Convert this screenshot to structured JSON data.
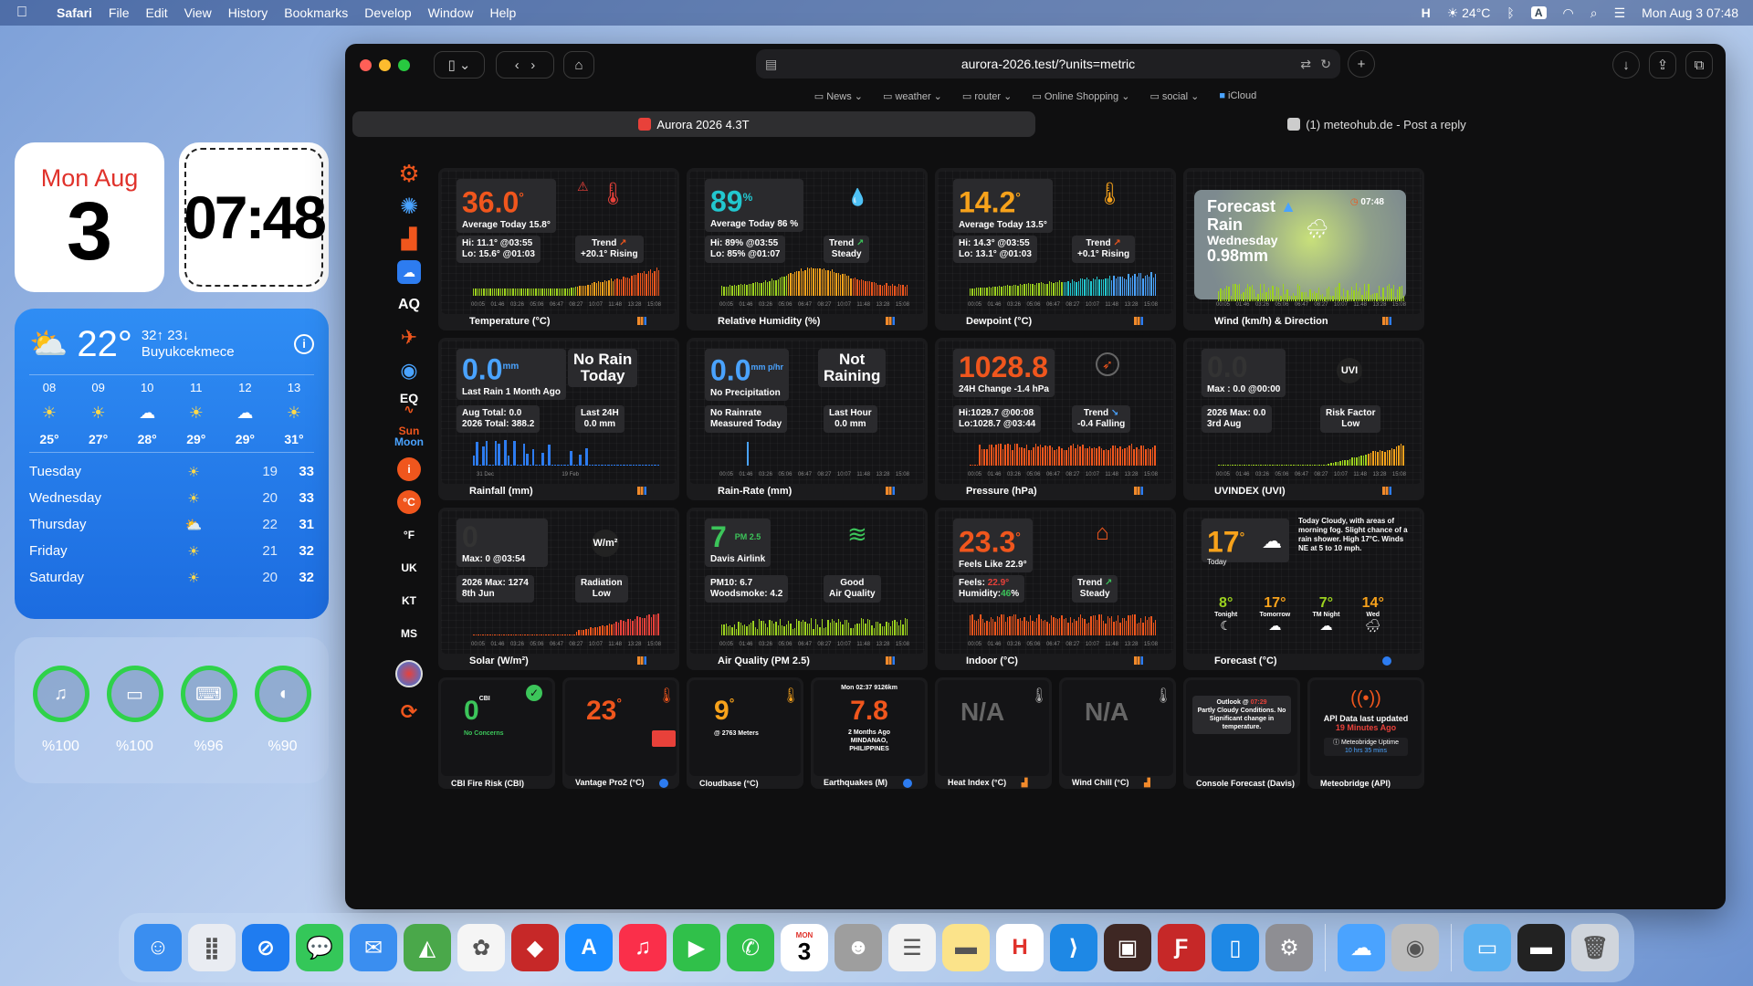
{
  "menubar": {
    "app": "Safari",
    "items": [
      "File",
      "Edit",
      "View",
      "History",
      "Bookmarks",
      "Develop",
      "Window",
      "Help"
    ],
    "weather": "24°C",
    "datetime": "Mon Aug 3  07:48",
    "input_badge": "A"
  },
  "widgets": {
    "date": {
      "day": "Mon Aug",
      "num": "3"
    },
    "clock": {
      "time": "07:48"
    },
    "weather": {
      "temp": "22°",
      "hl": "32↑ 23↓",
      "place": "Buyukcekmece",
      "hours": [
        {
          "h": "08",
          "t": "25°",
          "i": "☀"
        },
        {
          "h": "09",
          "t": "27°",
          "i": "☀"
        },
        {
          "h": "10",
          "t": "28°",
          "i": "☁"
        },
        {
          "h": "11",
          "t": "29°",
          "i": "☀"
        },
        {
          "h": "12",
          "t": "29°",
          "i": "☁"
        },
        {
          "h": "13",
          "t": "31°",
          "i": "☀"
        }
      ],
      "days": [
        {
          "d": "Tuesday",
          "lo": "19",
          "hi": "33",
          "i": "☀"
        },
        {
          "d": "Wednesday",
          "lo": "20",
          "hi": "33",
          "i": "☀"
        },
        {
          "d": "Thursday",
          "lo": "22",
          "hi": "31",
          "i": "⛅"
        },
        {
          "d": "Friday",
          "lo": "21",
          "hi": "32",
          "i": "☀"
        },
        {
          "d": "Saturday",
          "lo": "20",
          "hi": "32",
          "i": "☀"
        }
      ]
    },
    "batteries": [
      {
        "pct": "%100",
        "fill": 1.0
      },
      {
        "pct": "%100",
        "fill": 1.0
      },
      {
        "pct": "%96",
        "fill": 0.96
      },
      {
        "pct": "%90",
        "fill": 0.9
      }
    ]
  },
  "browser": {
    "url": "aurora-2026.test/?units=metric",
    "bookmarks": [
      "News",
      "weather",
      "router",
      "Online Shopping",
      "social",
      "iCloud"
    ],
    "tabs": [
      "Aurora 2026 4.3T",
      "(1) meteohub.de - Post a reply"
    ]
  },
  "sidebar": {
    "aq": "AQ",
    "eq": "EQ",
    "sun": "Sun",
    "moon": "Moon",
    "info": "i",
    "c": "°C",
    "f": "°F",
    "uk": "UK",
    "kt": "KT",
    "ms": "MS"
  },
  "cards": {
    "temp": {
      "value": "36.0",
      "unit": "°",
      "avg": "Average Today 15.8°",
      "hi": "Hi: 11.1° @03:55",
      "lo": "Lo: 15.6° @01:03",
      "trend": "Trend",
      "trend_val": "+20.1° Rising",
      "title": "Temperature (°C)"
    },
    "hum": {
      "value": "89",
      "unit": "%",
      "avg": "Average Today 86 %",
      "hi": "Hi: 89% @03:55",
      "lo": "Lo: 85% @01:07",
      "trend": "Trend",
      "trend_val": "Steady",
      "title": "Relative Humidity (%)"
    },
    "dew": {
      "value": "14.2",
      "unit": "°",
      "avg": "Average Today 13.5°",
      "hi": "Hi: 14.3° @03:55",
      "lo": "Lo: 13.1° @01:03",
      "trend": "Trend",
      "trend_val": "+0.1° Rising",
      "title": "Dewpoint (°C)"
    },
    "wind": {
      "line1": "Forecast",
      "line2": "Rain",
      "line3": "Wednesday",
      "line4": "0.98mm",
      "time": "07:48",
      "title": "Wind (km/h) & Direction"
    },
    "rain": {
      "value": "0.0",
      "unit": "mm",
      "sub": "Last Rain 1 Month Ago",
      "status1": "No Rain",
      "status2": "Today",
      "aug": "Aug Total: 0.0",
      "year": "2026 Total: 388.2",
      "l24": "Last 24H",
      "l24v": "0.0 mm",
      "x1": "31 Dec",
      "x2": "19 Feb",
      "title": "Rainfall (mm)"
    },
    "rrate": {
      "value": "0.0",
      "unit": "mm p/hr",
      "sub": "No Precipitation",
      "status1": "Not",
      "status2": "Raining",
      "n1": "No Rainrate",
      "n2": "Measured Today",
      "lh": "Last Hour",
      "lhv": "0.0 mm",
      "title": "Rain-Rate (mm)"
    },
    "press": {
      "value": "1028.8",
      "sub": "24H Change -1.4 hPa",
      "hi": "Hi:1029.7 @00:08",
      "lo": "Lo:1028.7 @03:44",
      "trend": "Trend",
      "trend_val": "-0.4 Falling",
      "title": "Pressure (hPa)"
    },
    "uv": {
      "value": "0.0",
      "max": "Max : 0.0 @00:00",
      "badge": "UVI",
      "ymax": "2026 Max: 0.0",
      "ydate": "3rd Aug",
      "rf": "Risk Factor",
      "rfv": "Low",
      "title": "UVINDEX (UVI)"
    },
    "solar": {
      "value": "0",
      "max": "Max: 0 @03:54",
      "badge": "W/m²",
      "ymax": "2026 Max: 1274",
      "ydate": "8th Jun",
      "rad": "Radiation",
      "radv": "Low",
      "title": "Solar (W/m²)"
    },
    "aq": {
      "value": "7",
      "unit": "PM 2.5",
      "sub": "Davis Airlink",
      "pm10": "PM10: 6.7",
      "wood": "Woodsmoke: 4.2",
      "q1": "Good",
      "q2": "Air Quality",
      "title": "Air Quality (PM 2.5)"
    },
    "indoor": {
      "value": "23.3",
      "unit": "°",
      "sub": "Feels Like 22.9°",
      "feels": "Feels:",
      "feelsv": "22.9°",
      "humid": "Humidity:",
      "humidv": "46",
      "trend": "Trend",
      "trend_val": "Steady",
      "title": "Indoor (°C)"
    },
    "fc": {
      "value": "17",
      "unit": "°",
      "today": "Today",
      "text": "Today Cloudy, with areas of morning fog. Slight chance of a rain shower. High 17°C. Winds NE at 5 to 10 mph.",
      "items": [
        {
          "t": "8°",
          "l": "Tonight"
        },
        {
          "t": "17°",
          "l": "Tomorrow"
        },
        {
          "t": "7°",
          "l": "TM Night"
        },
        {
          "t": "14°",
          "l": "Wed"
        }
      ],
      "title": "Forecast (°C)"
    }
  },
  "small": {
    "cbi": {
      "value": "0",
      "unit": "CBI",
      "sub": "No Concerns",
      "title": "CBI Fire Risk (CBI)"
    },
    "vp": {
      "value": "23",
      "unit": "°",
      "title": "Vantage Pro2 (°C)"
    },
    "cloud": {
      "value": "9",
      "unit": "°",
      "sub": "@ 2763 Meters",
      "title": "Cloudbase (°C)"
    },
    "eq": {
      "head": "Mon 02:37 9126km",
      "value": "7.8",
      "ago": "2 Months Ago",
      "place1": "MINDANAO,",
      "place2": "PHILIPPINES",
      "title": "Earthquakes (M)"
    },
    "heat": {
      "value": "N/A",
      "title": "Heat Index (°C)"
    },
    "chill": {
      "value": "N/A",
      "title": "Wind Chill (°C)"
    },
    "console": {
      "head": "Outlook @",
      "time": "07:29",
      "text": "Partly Cloudy Conditions. No Significant change in temperature.",
      "title": "Console Forecast (Davis)"
    },
    "api": {
      "l1": "API Data last updated",
      "l2": "19 Minutes Ago",
      "mb": "Meteobridge Uptime",
      "up": "10 hrs 35 mins",
      "title": "Meteobridge (API)"
    }
  },
  "dock": [
    "Finder",
    "Launchpad",
    "Safari",
    "Messages",
    "Mail",
    "Maps",
    "Photos",
    "Aurora",
    "App Store",
    "Music",
    "FaceTime",
    "Phone",
    "Calendar",
    "Contacts",
    "Reminders",
    "Notes",
    "H",
    "VS Code",
    "App",
    "FileZilla",
    "Configurator",
    "System Settings",
    "Weather",
    "Disk",
    "Downloads",
    "Terminal",
    "Trash"
  ],
  "dock_calendar": {
    "mon": "MON",
    "day": "3"
  }
}
